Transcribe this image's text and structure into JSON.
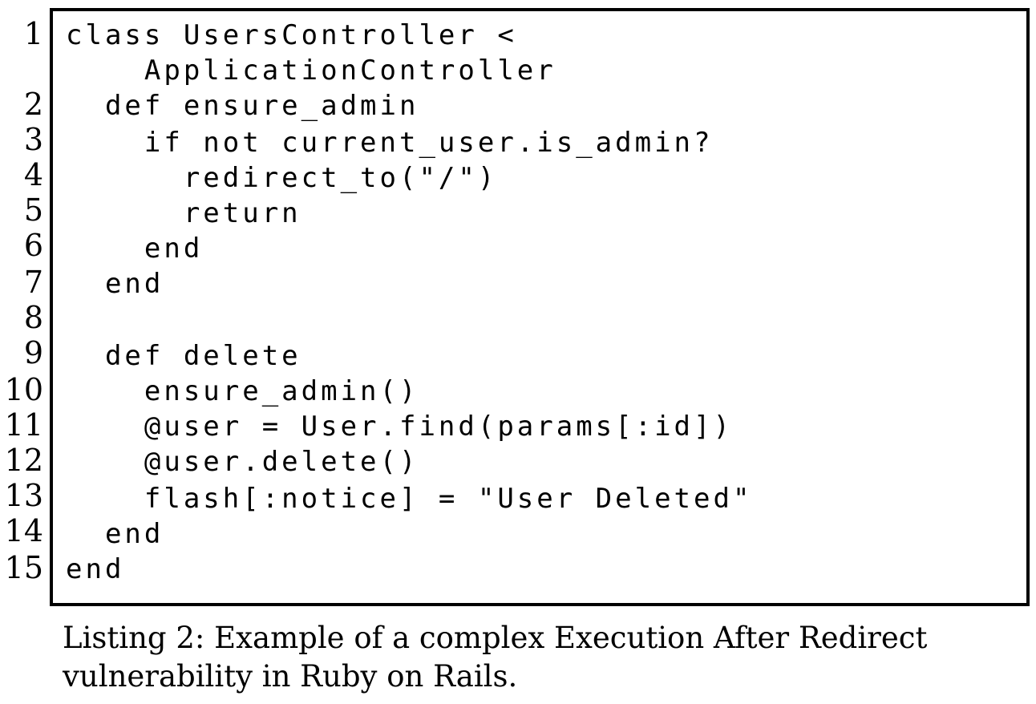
{
  "listing": {
    "lines": [
      {
        "number": "1",
        "code": "class UsersController <"
      },
      {
        "number": "",
        "code": "    ApplicationController"
      },
      {
        "number": "2",
        "code": "  def ensure_admin"
      },
      {
        "number": "3",
        "code": "    if not current_user.is_admin?"
      },
      {
        "number": "4",
        "code": "      redirect_to(\"/\")"
      },
      {
        "number": "5",
        "code": "      return"
      },
      {
        "number": "6",
        "code": "    end"
      },
      {
        "number": "7",
        "code": "  end"
      },
      {
        "number": "8",
        "code": ""
      },
      {
        "number": "9",
        "code": "  def delete"
      },
      {
        "number": "10",
        "code": "    ensure_admin()"
      },
      {
        "number": "11",
        "code": "    @user = User.find(params[:id])"
      },
      {
        "number": "12",
        "code": "    @user.delete()"
      },
      {
        "number": "13",
        "code": "    flash[:notice] = \"User Deleted\""
      },
      {
        "number": "14",
        "code": "  end"
      },
      {
        "number": "15",
        "code": "end"
      }
    ],
    "caption": "Listing 2: Example of a complex Execution After Redirect vulnerability in Ruby on Rails."
  }
}
